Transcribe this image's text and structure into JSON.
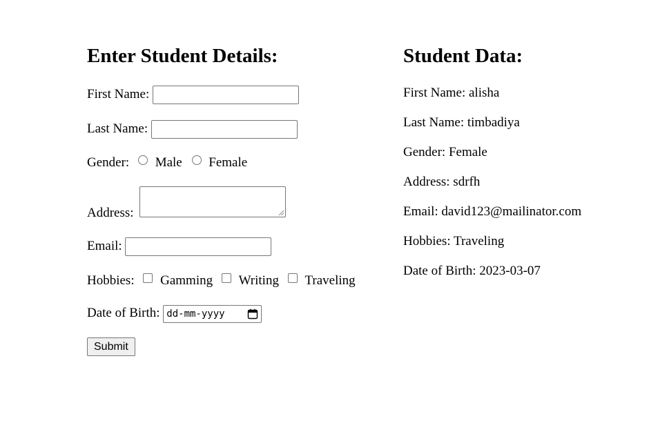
{
  "form": {
    "heading": "Enter Student Details:",
    "first_name_label": "First Name:",
    "first_name_value": "",
    "last_name_label": "Last Name:",
    "last_name_value": "",
    "gender_label": "Gender:",
    "gender_options": [
      "Male",
      "Female"
    ],
    "address_label": "Address:",
    "address_value": "",
    "email_label": "Email:",
    "email_value": "",
    "hobbies_label": "Hobbies:",
    "hobby_options": [
      "Gamming",
      "Writing",
      "Traveling"
    ],
    "dob_label": "Date of Birth:",
    "dob_placeholder": "dd-mm-yyyy",
    "submit_label": "Submit"
  },
  "student_data": {
    "heading": "Student Data:",
    "first_name": "First Name: alisha",
    "last_name": "Last Name: timbadiya",
    "gender": "Gender: Female",
    "address": "Address: sdrfh",
    "email": "Email: david123@mailinator.com",
    "hobbies": "Hobbies: Traveling",
    "dob": "Date of Birth: 2023-03-07"
  },
  "icons": {
    "calendar": "calendar-icon",
    "resize": "resize-grip-icon"
  }
}
